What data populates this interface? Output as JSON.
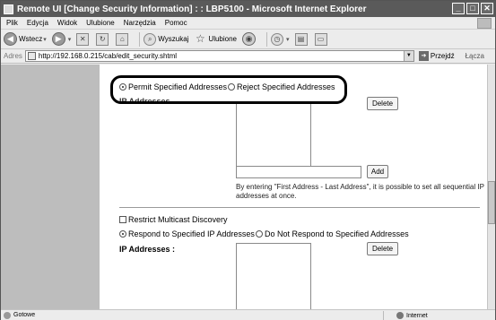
{
  "window": {
    "title": "Remote UI [Change Security Information] : : LBP5100 - Microsoft Internet Explorer",
    "controls": [
      "_",
      "□",
      "✕"
    ]
  },
  "menu": [
    "Plik",
    "Edycja",
    "Widok",
    "Ulubione",
    "Narzędzia",
    "Pomoc"
  ],
  "toolbar": {
    "back_label": "Wstecz",
    "search_label": "Wyszukaj",
    "favorites_label": "Ulubione"
  },
  "address": {
    "label": "Adres",
    "url": "http://192.168.0.215/cab/edit_security.shtml",
    "go_label": "Przejdź",
    "links_label": "Łącza"
  },
  "section1": {
    "permit_label": "Permit Specified Addresses",
    "reject_label": "Reject Specified Addresses",
    "permit_selected": true,
    "ip_label_fragment": "IP Addresses",
    "delete_label": "Delete",
    "add_input_value": "",
    "add_label": "Add",
    "hint_line1": "By entering \"First Address - Last Address\", it is possible to set all sequential IP",
    "hint_line2": "addresses at once."
  },
  "section2": {
    "multicast_label": "Restrict Multicast Discovery",
    "multicast_checked": false,
    "respond_label": "Respond to Specified IP Addresses",
    "not_respond_label": "Do Not Respond to Specified Addresses",
    "respond_selected": true,
    "ip_heading": "IP Addresses :",
    "delete_label": "Delete"
  },
  "status": {
    "text": "Gotowe",
    "zone": "Internet"
  }
}
